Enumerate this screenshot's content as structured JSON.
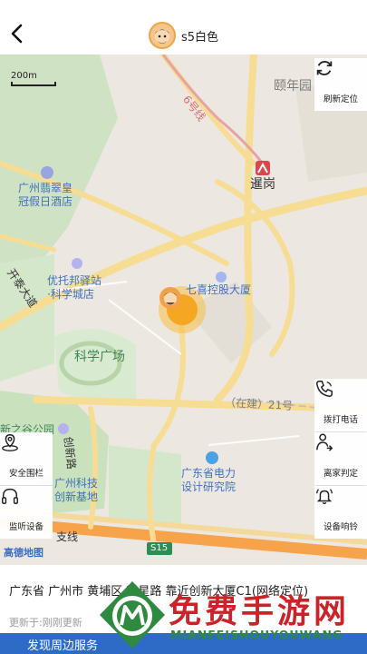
{
  "header": {
    "title": "s5白色",
    "back_icon": "chevron-left-icon"
  },
  "map": {
    "scale_label": "200m",
    "labels": {
      "yiniany": "颐年园",
      "line6": "6号线",
      "xiegang": "暹岗",
      "cuihuang_1": "广州翡翠皇",
      "cuihuang_2": "冠假日酒店",
      "kaitai": "开泰大道",
      "youtuo_1": "优托邦驿站",
      "youtuo_2": "·科学城店",
      "qixi": "七喜控股大厦",
      "kexue": "科学广场",
      "zaijian": "（在建）21号",
      "chuangxin": "创新路",
      "xin": "新之谷公园",
      "kechuang_1": "广州科技",
      "kechuang_2": "创新基地",
      "dianli_1": "广东省电力",
      "dianli_2": "设计研究院",
      "zhixian": "支线",
      "s15": "S15",
      "amap": "高德地图"
    },
    "colors": {
      "brand": "#2e6bc6",
      "metro": "#d9474c",
      "road": "#f7dc93",
      "park": "#cfe3c4"
    }
  },
  "side_buttons": {
    "refresh": {
      "label": "刷新定位",
      "icon": "refresh-icon"
    },
    "call": {
      "label": "拨打电话",
      "icon": "phone-icon"
    },
    "leave": {
      "label": "离家判定",
      "icon": "person-leave-icon"
    },
    "ring": {
      "label": "设备响铃",
      "icon": "bell-icon"
    },
    "fence": {
      "label": "安全围栏",
      "icon": "location-fence-icon"
    },
    "listen": {
      "label": "监听设备",
      "icon": "headphones-icon"
    }
  },
  "info": {
    "address": "广东省 广州市 黄埔区 科星路 靠近创新大厦C1(网络定位)",
    "updated": "更新于:刚刚更新"
  },
  "bottom": {
    "text": "发现周边服务"
  },
  "watermark": {
    "title": "免费手游网",
    "subtitle": "MIANFEISHOUYOUWANG"
  }
}
